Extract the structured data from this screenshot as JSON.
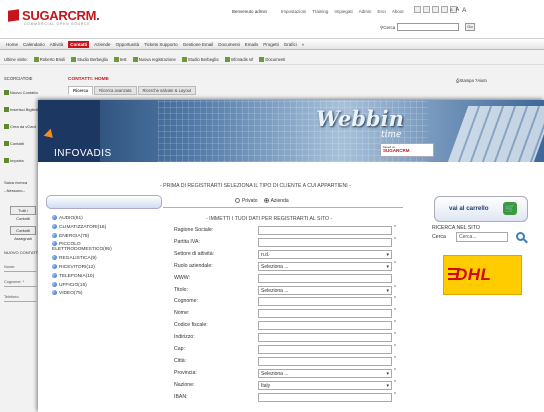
{
  "sugar": {
    "logo": "SUGARCRM.",
    "tagline": "COMMERCIAL OPEN SOURCE",
    "user_text": "Benvenuto admin",
    "tools": [
      "Impostazioni",
      "Training",
      "Impiegati",
      "Admin",
      "Esci",
      "About"
    ],
    "font_sizes": [
      "A",
      "A",
      "A"
    ],
    "search_label": "Cerca",
    "search_button": "Go",
    "nav": [
      "Home",
      "Calendario",
      "Attività",
      "Contatti",
      "Aziende",
      "Opportunità",
      "Tickets Supporto",
      "Gestione Email",
      "Documenti",
      "Emails",
      "Progetti",
      "Grafici",
      "»"
    ],
    "nav_active": "Contatti",
    "shortcuts": [
      "Ultime visite:",
      "Roberto Brioli",
      "Studio Berbeglia",
      "test",
      "Nuova registrazione",
      "Studio Berbeglia",
      "InfoVadis srl",
      "Documenti"
    ],
    "left": {
      "header": "SCORCIATOIE",
      "items": [
        "Nuovo Contatto",
        "Inserisci Biglietto",
        "Crea da vCard",
        "Contatti",
        "Importa"
      ],
      "saved_label": "Salva ricerca",
      "saved_value": "--Nessuno--",
      "btn1": "Tutti i Contatti",
      "btn2": "Contatti Assegnati",
      "recent_label": "NUOVO CONTATTO",
      "fields": [
        "Nome:",
        "Cognome: *",
        "Telefono:"
      ]
    },
    "content_title": "CONTATTI: HOME",
    "print_label": "Stampa",
    "help_label": "Aiuto",
    "tabs": [
      "Ricerca",
      "Ricerca avanzata",
      "Ricerche salvate & Layout"
    ]
  },
  "webbin": {
    "brand": "Webbin",
    "brand_sub": "time",
    "based_on": "based on",
    "based_sugar": "SUGARCRM",
    "logo_text": "INFOVADIS",
    "intro": "- PRIMA DI REGISTRARTI SELEZIONA IL TIPO DI CLIENTE A CUI APPARTIENI -",
    "radio": [
      {
        "label": "Privato",
        "selected": false
      },
      {
        "label": "Azienda",
        "selected": true
      }
    ],
    "immetti": "- IMMETTI I TUOI DATI PER REGISTRARTI AL SITO -",
    "categories": [
      "AUDIO(61)",
      "CLIMATIZZATORI(16)",
      "ENERGIA(78)",
      "PICCOLO ELETTRODOMESTICO(95)",
      "REGALISTICA(9)",
      "RICEVITORI(12)",
      "TELEFONIA(10)",
      "UFFICIO(15)",
      "VIDEO(75)"
    ],
    "form": [
      {
        "label": "Ragione Sociale:",
        "value": "",
        "select": false,
        "required": true
      },
      {
        "label": "Partita IVA:",
        "value": "",
        "select": false,
        "required": true
      },
      {
        "label": "Settore di attività:",
        "value": "n.d.",
        "select": true,
        "required": false
      },
      {
        "label": "Ruolo aziendale:",
        "value": "Seleziona ...",
        "select": true,
        "required": true
      },
      {
        "label": "WWW:",
        "value": "",
        "select": false,
        "required": false
      },
      {
        "label": "Titolo:",
        "value": "Seleziona ...",
        "select": true,
        "required": true
      },
      {
        "label": "Cognome:",
        "value": "",
        "select": false,
        "required": true
      },
      {
        "label": "Nome:",
        "value": "",
        "select": false,
        "required": true
      },
      {
        "label": "Codice fiscale:",
        "value": "",
        "select": false,
        "required": true
      },
      {
        "label": "Indirizzo:",
        "value": "",
        "select": false,
        "required": true
      },
      {
        "label": "Cap:",
        "value": "",
        "select": false,
        "required": true
      },
      {
        "label": "Città:",
        "value": "",
        "select": false,
        "required": true
      },
      {
        "label": "Provincia:",
        "value": "Seleziona ...",
        "select": true,
        "required": true
      },
      {
        "label": "Nazione:",
        "value": "Italy",
        "select": true,
        "required": true
      },
      {
        "label": "IBAN:",
        "value": "",
        "select": false,
        "required": true
      }
    ],
    "cart_label": "vai al carrello",
    "search_title": "RICERCA NEL SITO",
    "search_label": "Cerca",
    "search_placeholder": "Cerca...",
    "dhl": "DHL"
  }
}
